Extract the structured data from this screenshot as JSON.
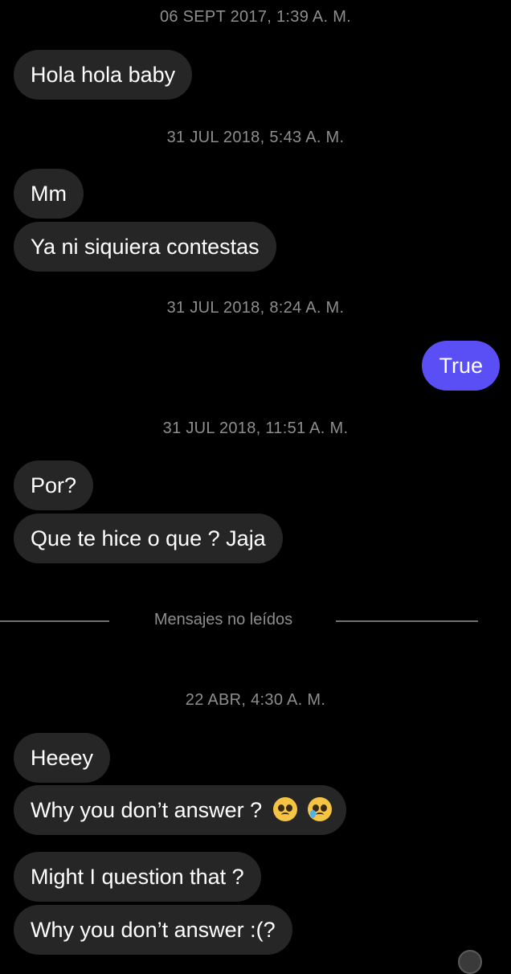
{
  "conversation": {
    "ts1": "06 SEPT 2017, 1:39 A. M.",
    "msg1": "Hola hola baby",
    "ts2": "31 JUL 2018, 5:43 A. M.",
    "msg2": "Mm",
    "msg3": "Ya ni siquiera contestas",
    "ts3": "31 JUL 2018, 8:24 A. M.",
    "msg4": "True",
    "ts4": "31 JUL 2018, 11:51 A. M.",
    "msg5": "Por?",
    "msg6": "Que te hice o que ? Jaja",
    "unread_label": "Mensajes no leídos",
    "ts5": "22 ABR, 4:30 A. M.",
    "msg7": "Heeey",
    "msg8": "Why you don’t answer ?",
    "msg8_emojis": [
      "pleading-face-emoji",
      "crying-face-emoji"
    ],
    "msg9": "Might I question that ?",
    "msg10": "Why you don’t answer :(?"
  },
  "colors": {
    "background": "#000000",
    "incoming_bubble": "#262626",
    "outgoing_bubble": "#5a4ff5",
    "timestamp_text": "#8e8e8e"
  }
}
